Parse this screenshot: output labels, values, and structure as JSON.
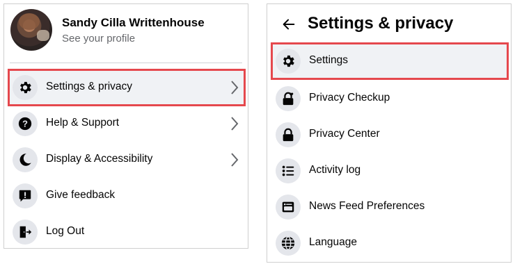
{
  "left_menu": {
    "profile": {
      "name": "Sandy Cilla Writtenhouse",
      "subtitle": "See your profile"
    },
    "items": [
      {
        "label": "Settings & privacy",
        "icon": "gear-icon",
        "has_chevron": true,
        "highlighted": true
      },
      {
        "label": "Help & Support",
        "icon": "question-icon",
        "has_chevron": true
      },
      {
        "label": "Display & Accessibility",
        "icon": "moon-icon",
        "has_chevron": true
      },
      {
        "label": "Give feedback",
        "icon": "feedback-icon",
        "has_chevron": false
      },
      {
        "label": "Log Out",
        "icon": "logout-icon",
        "has_chevron": false
      }
    ]
  },
  "right_menu": {
    "title": "Settings & privacy",
    "items": [
      {
        "label": "Settings",
        "icon": "gear-icon",
        "highlighted": true
      },
      {
        "label": "Privacy Checkup",
        "icon": "lock-heart-icon"
      },
      {
        "label": "Privacy Center",
        "icon": "lock-icon"
      },
      {
        "label": "Activity log",
        "icon": "list-icon"
      },
      {
        "label": "News Feed Preferences",
        "icon": "news-feed-icon"
      },
      {
        "label": "Language",
        "icon": "globe-icon"
      }
    ]
  },
  "colors": {
    "highlight_border": "#e5484d",
    "row_highlight_bg": "#f0f2f5",
    "icon_circle_bg": "#e4e6eb",
    "secondary_text": "#65676b"
  }
}
